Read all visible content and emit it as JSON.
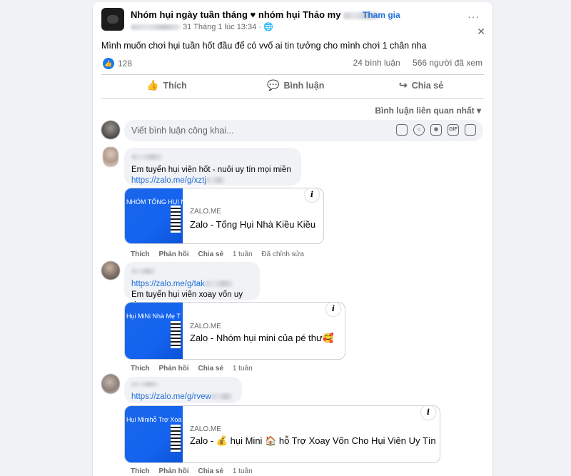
{
  "post": {
    "group_name": "Nhóm hụi ngày tuần tháng ♥ nhóm hụi Thảo my",
    "join_label": "Tham gia",
    "timestamp": "31 Tháng 1 lúc 13:34",
    "globe": "🌐",
    "more_label": "···",
    "close_label": "✕",
    "text": "Mình muốn chơi hụi tuần hốt đầu để có vvố ai tin tưởng cho mình chơi 1 chân nha",
    "like_icon": "👍",
    "like_count": "128",
    "comment_count": "24 bình luận",
    "view_count": "566 người đã xem"
  },
  "actions": {
    "like": "Thích",
    "like_icon": "👍",
    "comment": "Bình luận",
    "comment_icon": "💬",
    "share": "Chia sẻ",
    "share_icon": "↪"
  },
  "sort_label": "Bình luận liên quan nhất ▾",
  "composer": {
    "placeholder": "Viết bình luận công khai...",
    "icons": [
      "sticker-icon",
      "emoji-icon",
      "camera-icon",
      "gif-icon",
      "sticker-pack-icon"
    ],
    "icon_glyphs": [
      "",
      "☺",
      "◉",
      "GIF",
      ""
    ]
  },
  "comments": [
    {
      "line1": "Em tuyển hụi viên hốt - nuôi uy tín mọi miền",
      "link": "https://zalo.me/g/xztj",
      "preview": {
        "thumb_text": "NHÓM TỔNG HỤI N",
        "domain": "ZALO.ME",
        "title": "Zalo - Tổng Hụi Nhà Kiều Kiều",
        "info": "i"
      },
      "actions": {
        "like": "Thích",
        "reply": "Phản hồi",
        "share": "Chia sẻ",
        "time": "1 tuần",
        "edited": "Đã chỉnh sửa"
      }
    },
    {
      "link": "https://zalo.me/g/tak",
      "line2": "Em tuyển hụi viên xoay vốn uy tín",
      "preview": {
        "thumb_text": "Hụi MiNi Nhà Mẹ T",
        "domain": "ZALO.ME",
        "title": "Zalo - Nhóm hụi mini của pé thư🥰",
        "info": "i"
      },
      "actions": {
        "like": "Thích",
        "reply": "Phản hồi",
        "share": "Chia sẻ",
        "time": "1 tuần"
      }
    },
    {
      "link": "https://zalo.me/g/rvew",
      "preview": {
        "thumb_text": "Hụi Minihỗ Trợ Xoa",
        "domain": "ZALO.ME",
        "title": "Zalo - 💰 hụi Mini 🏠 hỗ Trợ Xoay Vốn Cho Hụi Viên Uy Tín",
        "info": "i"
      },
      "actions": {
        "like": "Thích",
        "reply": "Phản hồi",
        "share": "Chia sẻ",
        "time": "1 tuần"
      }
    }
  ]
}
